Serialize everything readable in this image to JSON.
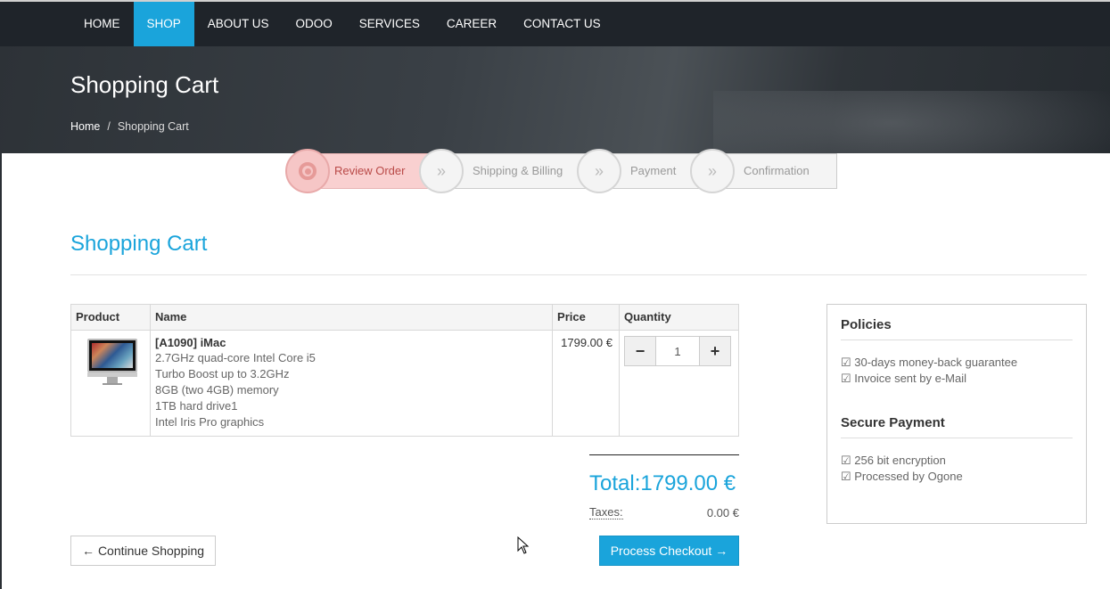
{
  "nav": {
    "items": [
      {
        "label": "HOME",
        "active": false
      },
      {
        "label": "SHOP",
        "active": true
      },
      {
        "label": "ABOUT US",
        "active": false
      },
      {
        "label": "ODOO",
        "active": false
      },
      {
        "label": "SERVICES",
        "active": false
      },
      {
        "label": "CAREER",
        "active": false
      },
      {
        "label": "CONTACT US",
        "active": false
      }
    ]
  },
  "hero": {
    "title": "Shopping Cart",
    "breadcrumb": {
      "home": "Home",
      "separator": "/",
      "current": "Shopping Cart"
    }
  },
  "steps": [
    {
      "label": "Review Order",
      "active": true,
      "icon": "target-icon"
    },
    {
      "label": "Shipping & Billing",
      "active": false,
      "icon": "double-chevron-right-icon"
    },
    {
      "label": "Payment",
      "active": false,
      "icon": "double-chevron-right-icon"
    },
    {
      "label": "Confirmation",
      "active": false,
      "icon": "double-chevron-right-icon"
    }
  ],
  "main": {
    "heading": "Shopping Cart"
  },
  "cart": {
    "headers": {
      "product": "Product",
      "name": "Name",
      "price": "Price",
      "quantity": "Quantity"
    },
    "items": [
      {
        "image": "imac-product-image",
        "name": "[A1090] iMac",
        "description": [
          "2.7GHz quad-core Intel Core i5",
          "Turbo Boost up to 3.2GHz",
          "8GB (two 4GB) memory",
          "1TB hard drive1",
          "Intel Iris Pro graphics"
        ],
        "price": "1799.00 €",
        "quantity": "1",
        "minus_label": "−",
        "plus_label": "+"
      }
    ]
  },
  "totals": {
    "total_label": "Total:",
    "total_value": "1799.00 €",
    "taxes_label": "Taxes:",
    "taxes_value": "0.00 €"
  },
  "actions": {
    "continue_label": "Continue Shopping",
    "continue_icon": "←",
    "checkout_label": "Process Checkout",
    "checkout_icon": "→"
  },
  "policies": {
    "heading": "Policies",
    "items": [
      "☑ 30-days money-back guarantee",
      "☑ Invoice sent by e-Mail"
    ],
    "secure_heading": "Secure Payment",
    "secure_items": [
      "☑ 256 bit encryption",
      "☑ Processed by Ogone"
    ]
  },
  "colors": {
    "accent": "#1aa4db",
    "navbar": "#1f242a",
    "active_step": "#f9d0d0"
  }
}
